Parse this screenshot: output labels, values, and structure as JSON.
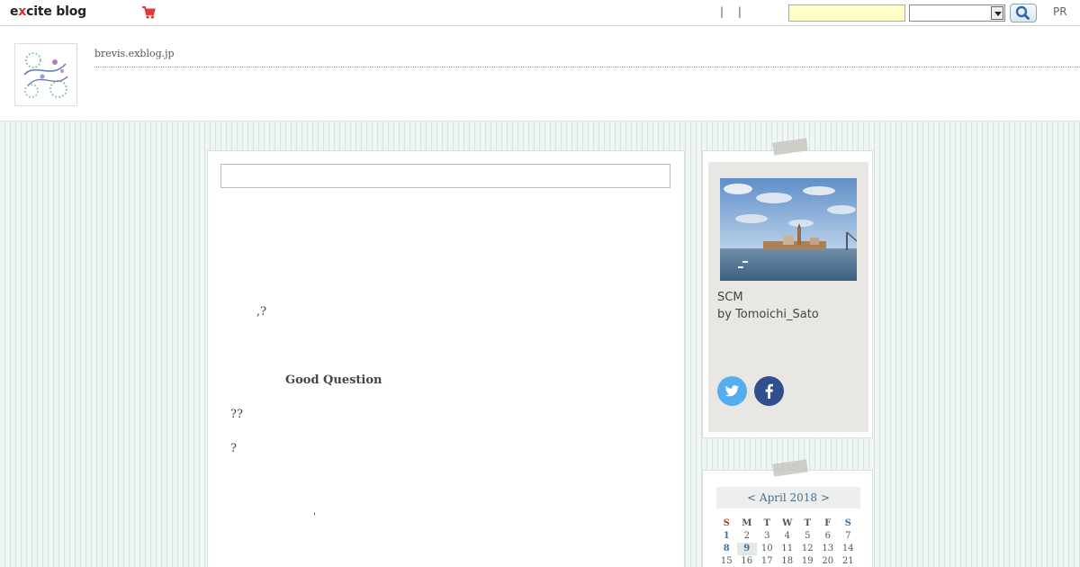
{
  "topbar": {
    "logo_prefix": "e",
    "logo_x": "x",
    "logo_suffix": "cite blog",
    "separators": "| |",
    "search_placeholder": "",
    "pr_label": "PR"
  },
  "header": {
    "blog_url": "brevis.exblog.jp"
  },
  "post": {
    "title": "",
    "line_q1": ",?",
    "heading": "Good Question",
    "line_q2": "??",
    "line_q3": "?",
    "line_mark": "'"
  },
  "profile": {
    "title": "SCM",
    "byline": "by Tomoichi_Sato",
    "twitter_color": "#55acee",
    "facebook_color": "#2f4f8f"
  },
  "calendar": {
    "header": "< April 2018 >",
    "dows": [
      "S",
      "M",
      "T",
      "W",
      "T",
      "F",
      "S"
    ],
    "rows": [
      [
        "1",
        "2",
        "3",
        "4",
        "5",
        "6",
        "7"
      ],
      [
        "8",
        "9",
        "10",
        "11",
        "12",
        "13",
        "14"
      ],
      [
        "15",
        "16",
        "17",
        "18",
        "19",
        "20",
        "21"
      ]
    ],
    "linked_days": [
      "1",
      "8",
      "9"
    ],
    "today": "9"
  },
  "colors": {
    "accent": "#3f6f9f",
    "page_background": "#eef7f3",
    "search_field": "#ffffc8",
    "brand_red": "#d0312d"
  }
}
